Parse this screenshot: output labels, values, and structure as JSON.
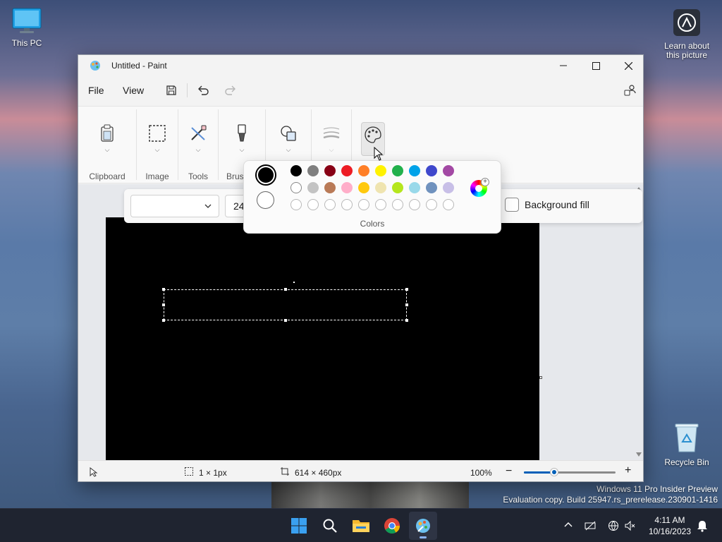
{
  "desktop": {
    "this_pc": "This PC",
    "learn_about": "Learn about this picture",
    "recycle_bin": "Recycle Bin",
    "watermark_line1": "Windows 11 Pro Insider Preview",
    "watermark_line2": "Evaluation copy. Build 25947.rs_prerelease.230901-1416"
  },
  "window": {
    "title": "Untitled - Paint",
    "menu": {
      "file": "File",
      "view": "View"
    }
  },
  "ribbon": {
    "groups": [
      "Clipboard",
      "Image",
      "Tools",
      "Brushes"
    ]
  },
  "textbar": {
    "font_family": "",
    "font_size": "24",
    "background_fill": "Background fill"
  },
  "colors_flyout": {
    "label": "Colors",
    "primary": "#000000",
    "secondary": "#ffffff",
    "row1": [
      "#000000",
      "#7f7f7f",
      "#880015",
      "#ed1c24",
      "#ff7f27",
      "#fff200",
      "#22b14c",
      "#00a2e8",
      "#3f48cc",
      "#a349a4"
    ],
    "row2": [
      "#ffffff",
      "#c3c3c3",
      "#b97a57",
      "#ffaec9",
      "#ffc90e",
      "#efe4b0",
      "#b5e61d",
      "#99d9ea",
      "#7092be",
      "#c8bfe7"
    ]
  },
  "status": {
    "selection_size": "1 × 1px",
    "canvas_size": "614 × 460px",
    "zoom": "100%",
    "zoom_fraction": 0.33
  },
  "taskbar": {
    "time": "4:11 AM",
    "date": "10/16/2023"
  }
}
